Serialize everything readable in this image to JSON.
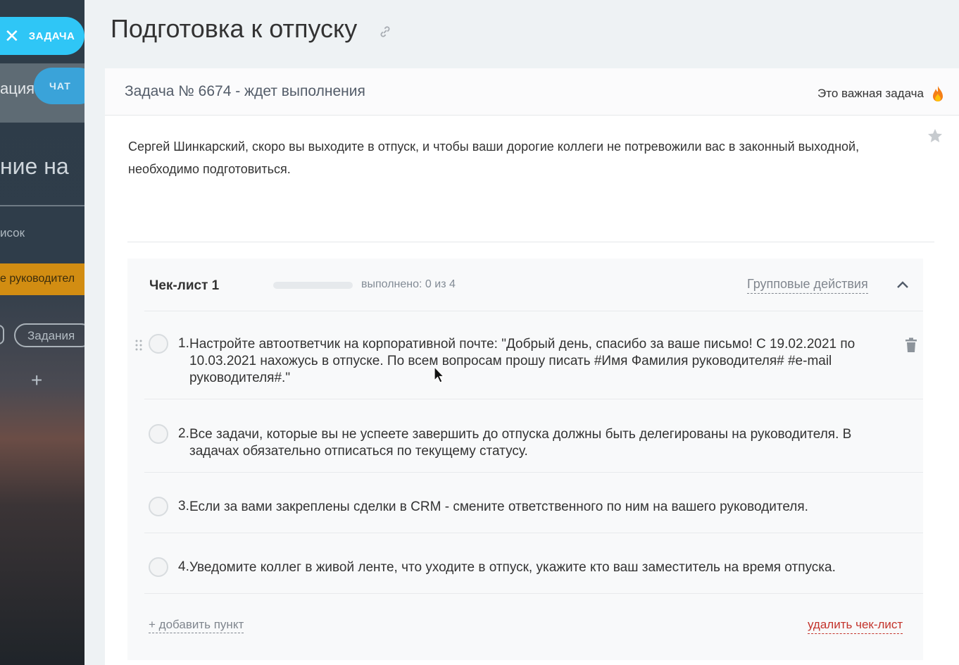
{
  "background": {
    "partial_title": "ация",
    "chat_label": "ЧАТ",
    "big_text": "ние на",
    "list_text": "исок",
    "orange_bar_text": "е руководител",
    "tasks_pill": "Задания",
    "plus": "+"
  },
  "close_pill": {
    "icon": "close-icon",
    "label": "ЗАДАЧА"
  },
  "page": {
    "title": "Подготовка к отпуску",
    "link_icon": "link-icon"
  },
  "task": {
    "number_status": "Задача № 6674 - ждет выполнения",
    "important_label": "Это важная задача",
    "important_icon": "fire-icon",
    "description": "Сергей Шинкарский, скоро вы выходите в отпуск, и чтобы ваши дорогие коллеги не потревожили вас в законный выходной, необходимо подготовиться.",
    "star_icon": "star-icon"
  },
  "checklist": {
    "title": "Чек-лист 1",
    "progress_fraction": 0,
    "done_label": "выполнено: 0 из 4",
    "group_actions": "Групповые действия",
    "collapse_icon": "chevron-up-icon",
    "items": [
      {
        "num": "1.",
        "text": "Настройте автоответчик на корпоративной почте: \"Добрый день, спасибо за ваше письмо! С 19.02.2021 по 10.03.2021 нахожусь в отпуске. По всем вопросам прошу писать #Имя Фамилия руководителя# #e-mail руководителя#.\""
      },
      {
        "num": "2.",
        "text": "Все задачи, которые вы не успеете завершить до отпуска должны быть делегированы на руководителя. В задачах обязательно отписаться по текущему статусу."
      },
      {
        "num": "3.",
        "text": "Если за вами закреплены сделки в CRM - смените ответственного по ним на вашего руководителя."
      },
      {
        "num": "4.",
        "text": "Уведомите коллег в живой ленте, что уходите в отпуск, укажите кто ваш заместитель на время отпуска."
      }
    ],
    "add_item": "+ добавить пункт",
    "delete_list": "удалить чек-лист"
  },
  "colors": {
    "accent": "#2fc6f6",
    "orange": "#d28d12",
    "danger": "#c3332b"
  }
}
